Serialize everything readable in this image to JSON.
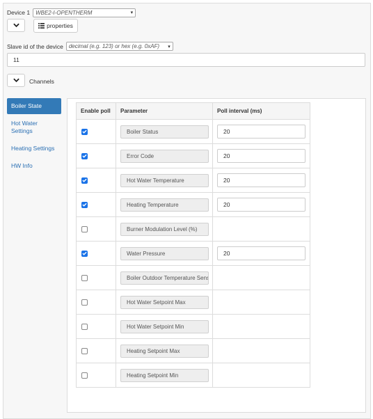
{
  "device": {
    "label": "Device 1",
    "selected": "WBE2-I-OPENTHERM",
    "properties_label": "properties"
  },
  "slave": {
    "label": "Slave id of the device",
    "format_selected": "decimal (e.g. 123) or hex (e.g. 0xAF)",
    "value": "11"
  },
  "channels": {
    "label": "Channels",
    "nav": [
      {
        "label": "Boiler State",
        "active": true
      },
      {
        "label": "Hot Water Settings",
        "active": false
      },
      {
        "label": "Heating Settings",
        "active": false
      },
      {
        "label": "HW Info",
        "active": false
      }
    ],
    "table": {
      "headers": [
        "Enable poll",
        "Parameter",
        "Poll interval (ms)"
      ],
      "rows": [
        {
          "enabled": true,
          "parameter": "Boiler Status",
          "interval": "20"
        },
        {
          "enabled": true,
          "parameter": "Error Code",
          "interval": "20"
        },
        {
          "enabled": true,
          "parameter": "Hot Water Temperature",
          "interval": "20"
        },
        {
          "enabled": true,
          "parameter": "Heating Temperature",
          "interval": "20"
        },
        {
          "enabled": false,
          "parameter": "Burner Modulation Level (%)",
          "interval": ""
        },
        {
          "enabled": true,
          "parameter": "Water Pressure",
          "interval": "20"
        },
        {
          "enabled": false,
          "parameter": "Boiler Outdoor Temperature Sensor",
          "interval": ""
        },
        {
          "enabled": false,
          "parameter": "Hot Water Setpoint Max",
          "interval": ""
        },
        {
          "enabled": false,
          "parameter": "Hot Water Setpoint Min",
          "interval": ""
        },
        {
          "enabled": false,
          "parameter": "Heating Setpoint Max",
          "interval": ""
        },
        {
          "enabled": false,
          "parameter": "Heating Setpoint Min",
          "interval": ""
        }
      ]
    }
  },
  "colors": {
    "accent": "#337ab7",
    "link": "#2a6fb3",
    "checkbox": "#1a73e8"
  },
  "icons": {
    "collapse": "chevron-down-icon",
    "list": "list-icon",
    "select": "select-caret-icon",
    "check": "checkmark-icon"
  }
}
